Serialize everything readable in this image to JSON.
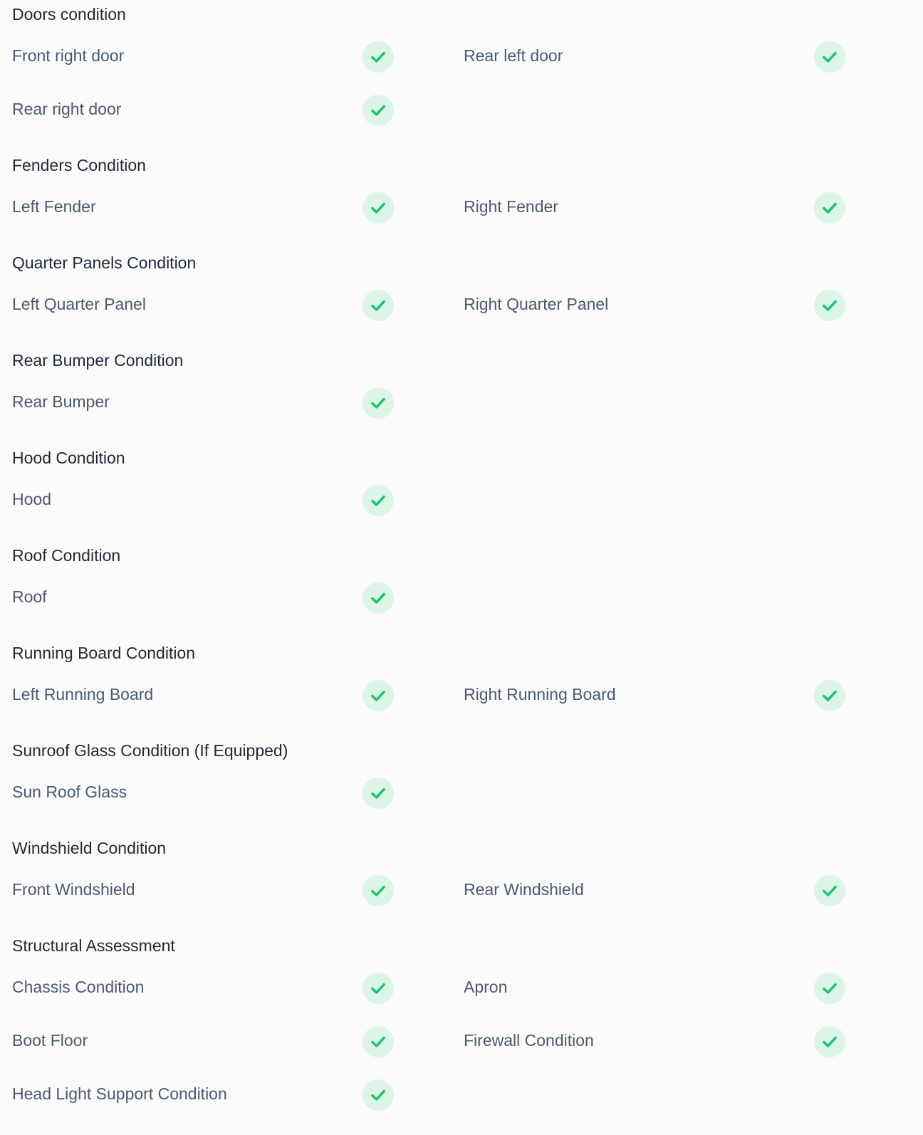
{
  "colors": {
    "background": "#fafafa",
    "heading": "#1f2937",
    "label": "#4b5a6e",
    "check": "#1ec270",
    "check_bg": "#dcf5e6"
  },
  "icons": {
    "status": "check-icon"
  },
  "sections": [
    {
      "title": "Doors condition",
      "items": [
        {
          "label": "Front right door",
          "status": "ok"
        },
        {
          "label": "Rear left door",
          "status": "ok"
        },
        {
          "label": "Rear right door",
          "status": "ok"
        }
      ]
    },
    {
      "title": "Fenders Condition",
      "items": [
        {
          "label": "Left Fender",
          "status": "ok"
        },
        {
          "label": "Right Fender",
          "status": "ok"
        }
      ]
    },
    {
      "title": "Quarter Panels Condition",
      "items": [
        {
          "label": "Left Quarter Panel",
          "status": "ok"
        },
        {
          "label": "Right Quarter Panel",
          "status": "ok"
        }
      ]
    },
    {
      "title": "Rear Bumper Condition",
      "items": [
        {
          "label": "Rear Bumper",
          "status": "ok"
        }
      ]
    },
    {
      "title": "Hood Condition",
      "items": [
        {
          "label": "Hood",
          "status": "ok"
        }
      ]
    },
    {
      "title": "Roof Condition",
      "items": [
        {
          "label": "Roof",
          "status": "ok"
        }
      ]
    },
    {
      "title": "Running Board Condition",
      "items": [
        {
          "label": "Left Running Board",
          "status": "ok"
        },
        {
          "label": "Right Running Board",
          "status": "ok"
        }
      ]
    },
    {
      "title": "Sunroof Glass Condition (If Equipped)",
      "items": [
        {
          "label": "Sun Roof Glass",
          "status": "ok"
        }
      ]
    },
    {
      "title": "Windshield Condition",
      "items": [
        {
          "label": "Front Windshield",
          "status": "ok"
        },
        {
          "label": "Rear Windshield",
          "status": "ok"
        }
      ]
    },
    {
      "title": "Structural Assessment",
      "items": [
        {
          "label": "Chassis Condition",
          "status": "ok"
        },
        {
          "label": "Apron",
          "status": "ok"
        },
        {
          "label": "Boot Floor",
          "status": "ok"
        },
        {
          "label": "Firewall Condition",
          "status": "ok"
        },
        {
          "label": "Head Light Support Condition",
          "status": "ok"
        }
      ]
    }
  ]
}
